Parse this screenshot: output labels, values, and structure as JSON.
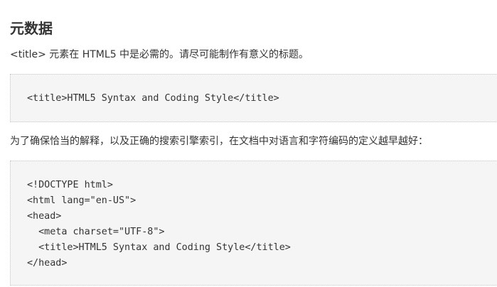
{
  "heading": "元数据",
  "intro_text": "<title> 元素在 HTML5 中是必需的。请尽可能制作有意义的标题。",
  "code_block_1": {
    "lines": [
      "<title>HTML5 Syntax and Coding Style</title>"
    ]
  },
  "charset_text": "为了确保恰当的解释，以及正确的搜索引擎索引，在文档中对语言和字符编码的定义越早越好：",
  "code_block_2": {
    "lines": [
      "<!DOCTYPE html>",
      "<html lang=\"en-US\">",
      "<head>",
      "  <meta charset=\"UTF-8\">",
      "  <title>HTML5 Syntax and Coding Style</title>",
      "</head>"
    ]
  }
}
